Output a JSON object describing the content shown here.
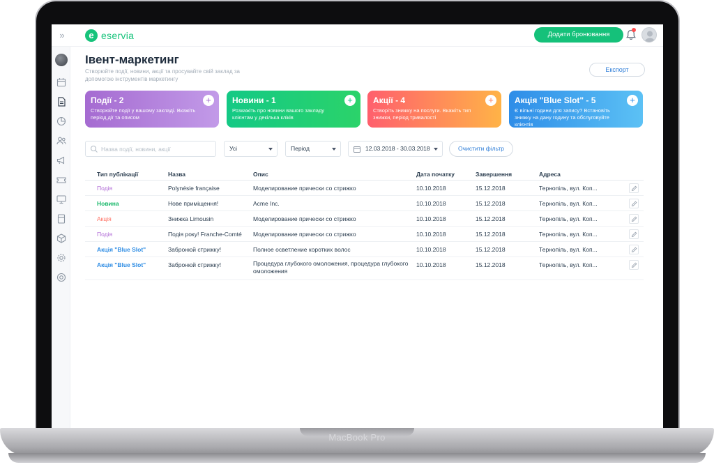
{
  "device": {
    "label": "MacBook Pro"
  },
  "topbar": {
    "logo_mark": "e",
    "logo_text": "eservia",
    "add_booking": "Додати бронювання"
  },
  "page": {
    "title": "Івент-маркетинг",
    "subtitle": "Створюйте події, новини, акції та просувайте свій заклад за допомогою інструментів маркетингу",
    "export": "Експорт"
  },
  "cards": [
    {
      "title": "Події - 2",
      "desc": "Створюйте події у вашому закладі. Вкажіть період дії та описом",
      "color": "#a56bd1"
    },
    {
      "title": "Новини - 1",
      "desc": "Розкажіть про новини вашого закладу клієнтам у декілька кліків",
      "color": "#14c985"
    },
    {
      "title": "Акції - 4",
      "desc": "Створіть знижку на послуги. Вкажіть тип знижки, період тривалості",
      "color": "#ff7d5a"
    },
    {
      "title": "Акція \"Blue Slot\" - 5",
      "desc": "Є вільні години для запису? Встановіть знижку на дану годину та обслуговуйте клієнтів",
      "color": "#2e8de8"
    }
  ],
  "filters": {
    "search_placeholder": "Назва події, новини, акції",
    "type_value": "Усі",
    "period_value": "Період",
    "date_range": "12.03.2018 - 30.03.2018",
    "clear": "Очистити фільтр"
  },
  "table": {
    "headers": [
      "Тип публікації",
      "Назва",
      "Опис",
      "Дата початку",
      "Завершення",
      "Адреса"
    ],
    "rows": [
      {
        "type": "Подія",
        "name": "Polynésie française",
        "desc": "Моделирование прически со стрижко",
        "start": "10.10.2018",
        "end": "15.12.2018",
        "addr": "Тернопіль, вул. Коп..."
      },
      {
        "type": "Новина",
        "name": "Нове приміщення!",
        "desc": "Acme Inc.",
        "start": "10.10.2018",
        "end": "15.12.2018",
        "addr": "Тернопіль, вул. Коп..."
      },
      {
        "type": "Акція",
        "name": "Знижка Limousin",
        "desc": "Моделирование прически со стрижко",
        "start": "10.10.2018",
        "end": "15.12.2018",
        "addr": "Тернопіль, вул. Коп..."
      },
      {
        "type": "Подія",
        "name": "Подія року! Franche-Comté",
        "desc": "Моделирование прически со стрижко",
        "start": "10.10.2018",
        "end": "15.12.2018",
        "addr": "Тернопіль, вул. Коп..."
      },
      {
        "type": "Акція \"Blue Slot\"",
        "name": "Забронюй стрижку!",
        "desc": "Полное осветление коротких волос",
        "start": "10.10.2018",
        "end": "15.12.2018",
        "addr": "Тернопіль, вул. Коп..."
      },
      {
        "type": "Акція \"Blue Slot\"",
        "name": "Забронюй стрижку!",
        "desc": "Процедура глубокого омоложения, процедура глубокого омоложения",
        "start": "10.10.2018",
        "end": "15.12.2018",
        "addr": "Тернопіль, вул. Коп..."
      }
    ]
  },
  "sidebar": {
    "icons": [
      "calendar-icon",
      "document-icon",
      "pie-chart-icon",
      "users-icon",
      "megaphone-icon",
      "ticket-icon",
      "monitor-icon",
      "calculator-icon",
      "box-icon",
      "gear-icon",
      "lifebuoy-icon"
    ]
  }
}
